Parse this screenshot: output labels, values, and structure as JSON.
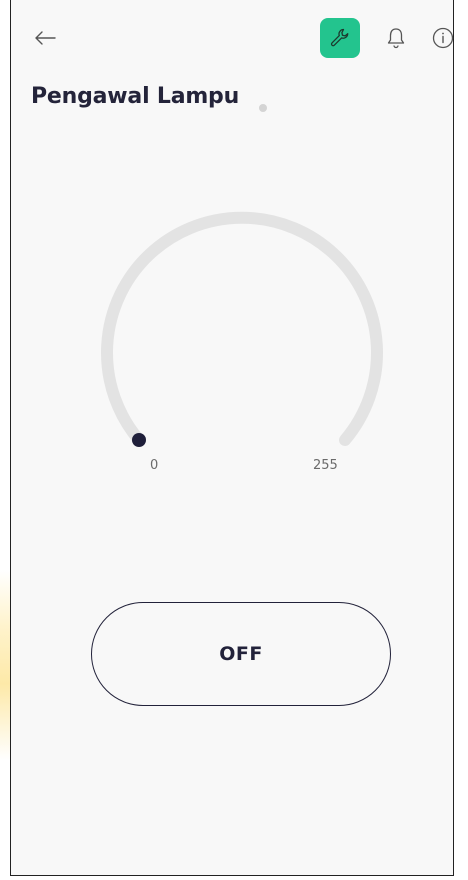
{
  "header": {
    "back_icon": "arrow-left-icon",
    "settings_icon": "wrench-icon",
    "notifications_icon": "bell-icon",
    "info_icon": "info-icon",
    "accent_color": "#23c48e"
  },
  "title": "Pengawal Lampu",
  "gauge": {
    "min_label": "0",
    "max_label": "255",
    "value": 0,
    "track_color": "#e3e3e3",
    "knob_color": "#1f1f3a"
  },
  "toggle": {
    "label": "OFF"
  }
}
